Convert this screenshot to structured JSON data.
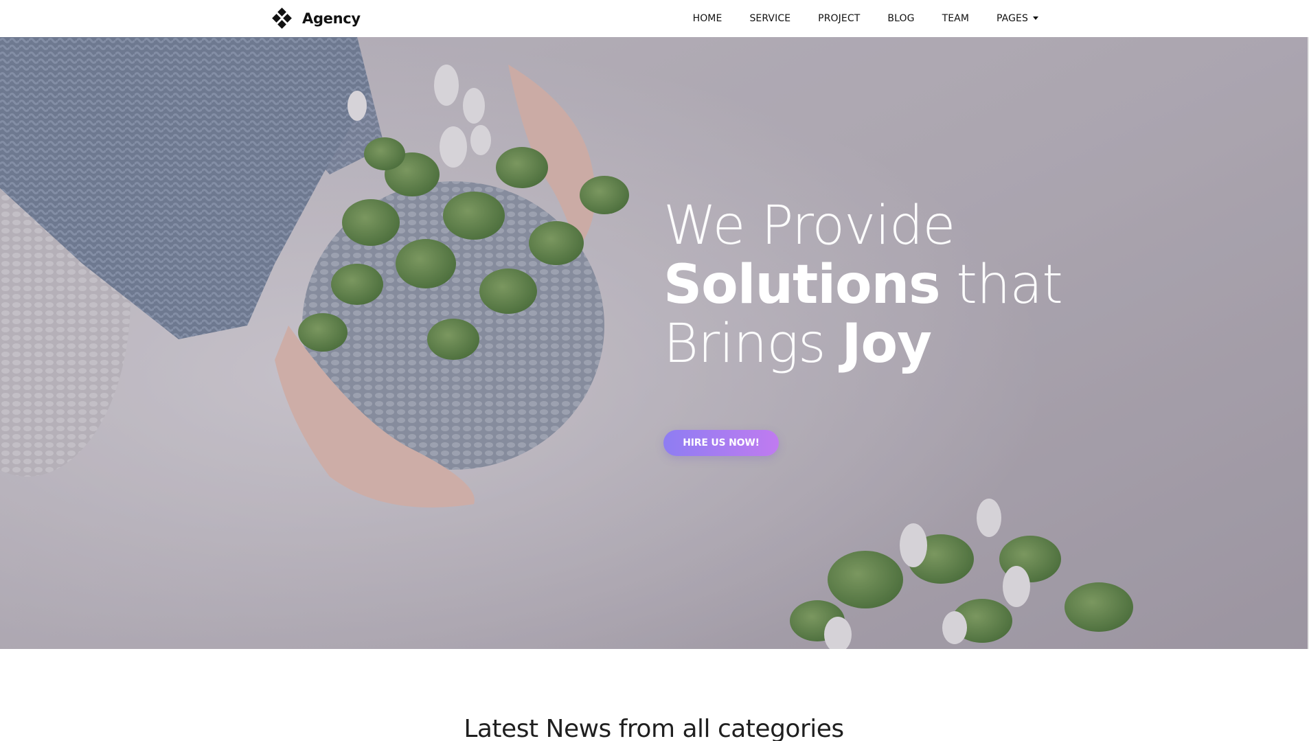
{
  "navbar": {
    "brand_name": "Agency",
    "logo_icon": "diamond-cluster-icon",
    "items": [
      {
        "label": "HOME"
      },
      {
        "label": "SERVICE"
      },
      {
        "label": "PROJECT"
      },
      {
        "label": "BLOG"
      },
      {
        "label": "TEAM"
      },
      {
        "label": "PAGES"
      }
    ]
  },
  "hero": {
    "line1": "We Provide",
    "line2_bold": "Solutions",
    "line2_thin": "that",
    "line3_thin": "Brings",
    "line3_bold": "Joy",
    "cta_label": "HIRE US NOW!"
  },
  "news": {
    "title": "Latest News from all categories"
  },
  "colors": {
    "cta_gradient_start": "#8e7df2",
    "cta_gradient_end": "#c07bf0",
    "hero_text": "#ffffff"
  }
}
